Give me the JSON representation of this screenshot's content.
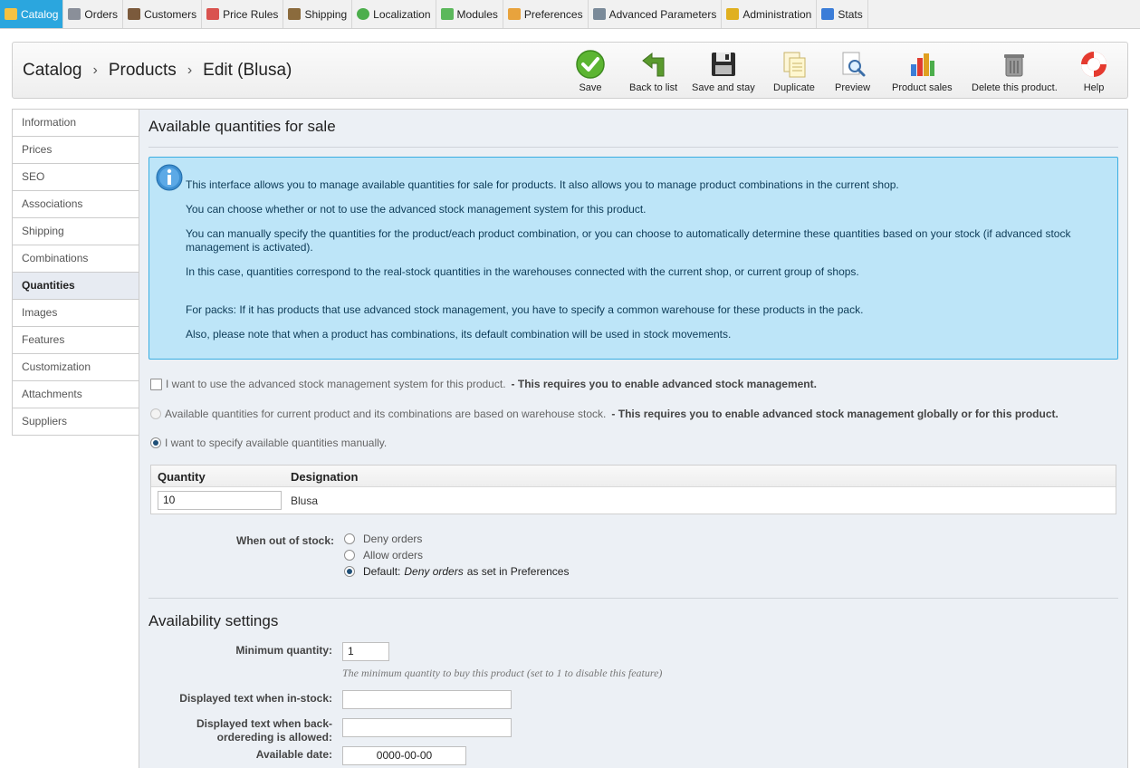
{
  "nav": {
    "tabs": [
      {
        "label": "Catalog",
        "icon": "folder-icon",
        "color": "#f5c242"
      },
      {
        "label": "Orders",
        "icon": "cart-icon",
        "color": "#8a8f99"
      },
      {
        "label": "Customers",
        "icon": "customer-icon",
        "color": "#7b5a3c"
      },
      {
        "label": "Price Rules",
        "icon": "price-rules-icon",
        "color": "#d9534f"
      },
      {
        "label": "Shipping",
        "icon": "truck-icon",
        "color": "#8b6b3d"
      },
      {
        "label": "Localization",
        "icon": "globe-icon",
        "color": "#4cae4c"
      },
      {
        "label": "Modules",
        "icon": "puzzle-icon",
        "color": "#5cb85c"
      },
      {
        "label": "Preferences",
        "icon": "preferences-icon",
        "color": "#e8a33d"
      },
      {
        "label": "Advanced Parameters",
        "icon": "wrench-icon",
        "color": "#7a8a99"
      },
      {
        "label": "Administration",
        "icon": "key-icon",
        "color": "#e0b020"
      },
      {
        "label": "Stats",
        "icon": "bar-chart-icon",
        "color": "#3b7dd8"
      }
    ]
  },
  "breadcrumb": {
    "items": [
      "Catalog",
      "Products",
      "Edit (Blusa)"
    ],
    "separator": "›"
  },
  "toolbar": {
    "save": "Save",
    "back": "Back to list",
    "save_stay": "Save and stay",
    "duplicate": "Duplicate",
    "preview": "Preview",
    "product_sales": "Product sales",
    "delete": "Delete this product.",
    "help": "Help"
  },
  "sidebar": {
    "items": [
      "Information",
      "Prices",
      "SEO",
      "Associations",
      "Shipping",
      "Combinations",
      "Quantities",
      "Images",
      "Features",
      "Customization",
      "Attachments",
      "Suppliers"
    ]
  },
  "quantities": {
    "title": "Available quantities for sale",
    "info": [
      "This interface allows you to manage available quantities for sale for products. It also allows you to manage product combinations in the current shop.",
      "You can choose whether or not to use the advanced stock management system for this product.",
      "You can manually specify the quantities for the product/each product combination, or you can choose to automatically determine these quantities based on your stock (if advanced stock management is activated).",
      "In this case, quantities correspond to the real-stock quantities in the warehouses connected with the current shop, or current group of shops.",
      "For packs: If it has products that use advanced stock management, you have to specify a common warehouse for these products in the pack.",
      "Also, please note that when a product has combinations, its default combination will be used in stock movements."
    ],
    "opt_advanced": "I want to use the advanced stock management system for this product.",
    "opt_advanced_note": "- This requires you to enable advanced stock management.",
    "opt_warehouse": "Available quantities for current product and its combinations are based on warehouse stock.",
    "opt_warehouse_note": "- This requires you to enable advanced stock management globally or for this product.",
    "opt_manual": "I want to specify available quantities manually.",
    "table": {
      "col_quantity": "Quantity",
      "col_designation": "Designation",
      "quantity_value": "10",
      "designation_value": "Blusa"
    },
    "out_of_stock": {
      "label": "When out of stock:",
      "deny": "Deny orders",
      "allow": "Allow orders",
      "default_prefix": "Default:",
      "default_value": "Deny orders",
      "default_suffix": "as set in Preferences"
    }
  },
  "availability": {
    "title": "Availability settings",
    "min_qty_label": "Minimum quantity:",
    "min_qty_value": "1",
    "min_qty_hint": "The minimum quantity to buy this product (set to 1 to disable this feature)",
    "in_stock_label": "Displayed text when in-stock:",
    "in_stock_value": "",
    "backorder_label": "Displayed text when back-ordereding is allowed:",
    "backorder_value": "",
    "date_label": "Available date:",
    "date_value": "0000-00-00"
  },
  "colors": {
    "accent": "#2ba6de",
    "info_bg": "#bde5f8",
    "info_border": "#3aaee2",
    "panel_bg": "#ecf0f5"
  }
}
